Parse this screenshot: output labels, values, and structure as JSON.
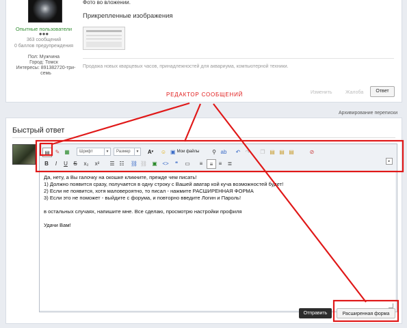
{
  "post": {
    "photo_text": "Фото во вложении.",
    "attachments_title": "Прикрепленные изображения",
    "signature": "Продажа новых кварцевых часов, принадлежностей для аквариума, компьютерной техники.",
    "actions": {
      "change": "Изменить",
      "complain": "Жалоба",
      "reply": "Ответ"
    }
  },
  "user": {
    "group": "Опытные пользователи",
    "messages": "363 сообщений",
    "warnings": "0 баллов предупреждения",
    "gender": "Пол: Мужчина",
    "city": "Город: Томск",
    "interests": "Интересы: 891382720-три-семь"
  },
  "annotation": {
    "editor_label": "РЕДАКТОР СООБЩЕНИЙ"
  },
  "archive_link": "Архивирование переписки",
  "quick_reply": {
    "title": "Быстрый ответ",
    "toolbar": {
      "font_placeholder": "Шрифт",
      "size_placeholder": "Размер",
      "my_files": "Мои файлы",
      "format_buttons": [
        "B",
        "I",
        "U",
        "S",
        "x₂",
        "x²"
      ]
    },
    "message_lines": [
      "Да, нету, а Вы галочку на окошке кликните, прежде чем писать!",
      "1) Должно появится сразу, получается в одну строку с Вашей аватар кой куча возможностей будет!",
      "2) Если не появится, хотя маловероятно, то писал - нажмите РАСШИРЕННАЯ ФОРМА",
      "3) Если это не поможет - выйдите с форума, и повторно введите Логин и Пароль!",
      "",
      "в остальных случаях, напишите мне. Все сделаю, просмотрю настройки профиля",
      "",
      "Удачи Вам!"
    ],
    "send_label": "Отправить",
    "extended_label": "Расширенная форма"
  },
  "colors": {
    "annotation_red": "#e01818",
    "send_button": "#2d2d2d"
  }
}
